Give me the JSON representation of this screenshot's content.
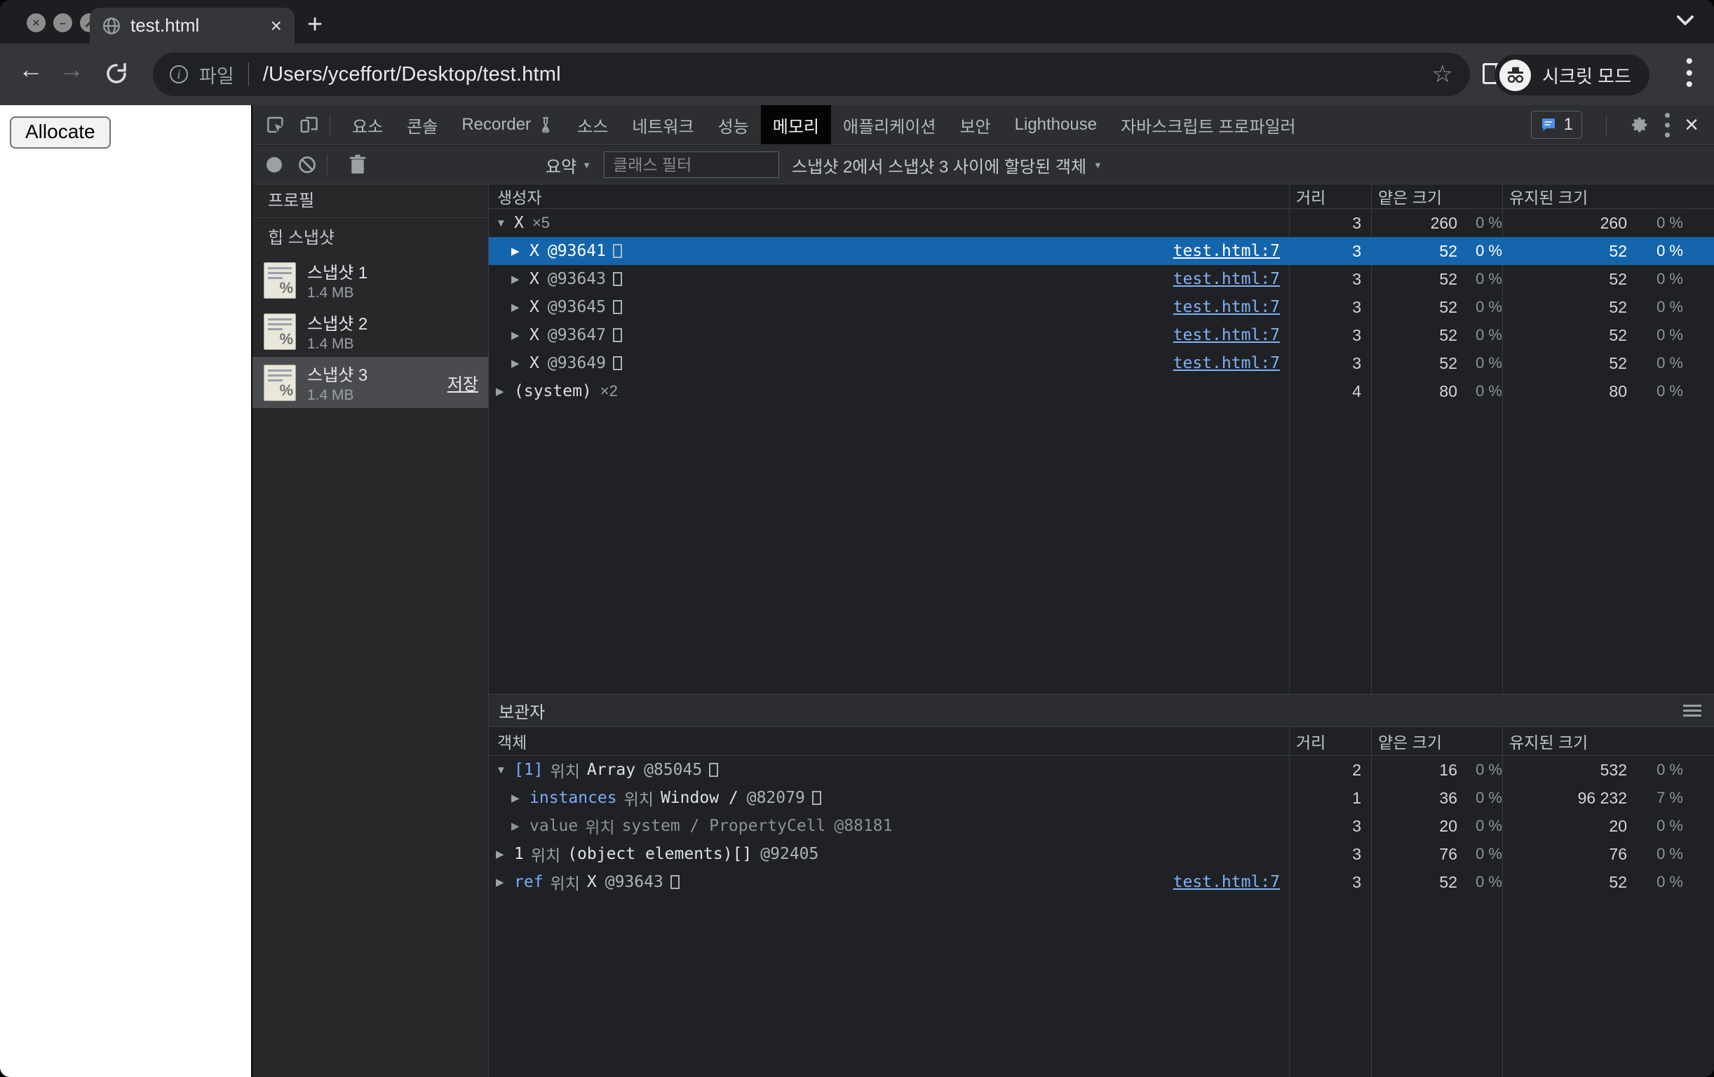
{
  "colors": {
    "selection_blue": "#1565ad",
    "link_blue": "#80b1f5",
    "property_blue": "#7cacf8",
    "selected_tab_bg": "#000000",
    "page_bg": "#ffffff"
  },
  "browser": {
    "window_controls": [
      "close",
      "minimize",
      "fullscreen"
    ],
    "tab_title": "test.html",
    "url_scheme": "파일",
    "url_path": "/Users/yceffort/Desktop/test.html",
    "incognito_label": "시크릿 모드"
  },
  "page": {
    "allocate_label": "Allocate"
  },
  "devtools": {
    "tabs": [
      {
        "label": "요소"
      },
      {
        "label": "콘솔"
      },
      {
        "label": "Recorder",
        "flask": true
      },
      {
        "label": "소스"
      },
      {
        "label": "네트워크"
      },
      {
        "label": "성능"
      },
      {
        "label": "메모리",
        "selected": true
      },
      {
        "label": "애플리케이션"
      },
      {
        "label": "보안"
      },
      {
        "label": "Lighthouse"
      },
      {
        "label": "자바스크립트 프로파일러"
      }
    ],
    "issues_count": "1",
    "toolbar": {
      "summary_label": "요약",
      "filter_placeholder": "클래스 필터",
      "allocation_filter": "스냅샷 2에서 스냅샷 3 사이에 할당된 객체"
    },
    "sidebar": {
      "profiles_label": "프로필",
      "section_label": "힙 스냅샷",
      "snapshots": [
        {
          "name": "스냅샷 1",
          "size": "1.4 MB"
        },
        {
          "name": "스냅샷 2",
          "size": "1.4 MB"
        },
        {
          "name": "스냅샷 3",
          "size": "1.4 MB",
          "selected": true,
          "save_label": "저장"
        }
      ]
    },
    "constructors": {
      "columns": {
        "constructor": "생성자",
        "distance": "거리",
        "shallow": "얕은 크기",
        "retained": "유지된 크기"
      },
      "rows": [
        {
          "indent": 0,
          "exp": "▼",
          "name": "X",
          "count": "×5",
          "dist": "3",
          "sh": "260",
          "shp": "0 %",
          "re": "260",
          "rep": "0 %"
        },
        {
          "indent": 1,
          "exp": "▶",
          "name": "X",
          "id": "@93641",
          "box": true,
          "link": "test.html:7",
          "dist": "3",
          "sh": "52",
          "shp": "0 %",
          "re": "52",
          "rep": "0 %",
          "selected": true
        },
        {
          "indent": 1,
          "exp": "▶",
          "name": "X",
          "id": "@93643",
          "box": true,
          "link": "test.html:7",
          "dist": "3",
          "sh": "52",
          "shp": "0 %",
          "re": "52",
          "rep": "0 %"
        },
        {
          "indent": 1,
          "exp": "▶",
          "name": "X",
          "id": "@93645",
          "box": true,
          "link": "test.html:7",
          "dist": "3",
          "sh": "52",
          "shp": "0 %",
          "re": "52",
          "rep": "0 %"
        },
        {
          "indent": 1,
          "exp": "▶",
          "name": "X",
          "id": "@93647",
          "box": true,
          "link": "test.html:7",
          "dist": "3",
          "sh": "52",
          "shp": "0 %",
          "re": "52",
          "rep": "0 %"
        },
        {
          "indent": 1,
          "exp": "▶",
          "name": "X",
          "id": "@93649",
          "box": true,
          "link": "test.html:7",
          "dist": "3",
          "sh": "52",
          "shp": "0 %",
          "re": "52",
          "rep": "0 %"
        },
        {
          "indent": 0,
          "exp": "▶",
          "name": "(system)",
          "count": "×2",
          "dist": "4",
          "sh": "80",
          "shp": "0 %",
          "re": "80",
          "rep": "0 %"
        }
      ]
    },
    "retainers": {
      "title": "보관자",
      "columns": {
        "object": "객체",
        "distance": "거리",
        "shallow": "얕은 크기",
        "retained": "유지된 크기"
      },
      "rows": [
        {
          "indent": 0,
          "exp": "▼",
          "prop": "[1]",
          "prop_style": "blue",
          "in": "위치",
          "obj": "Array",
          "id": "@85045",
          "box": true,
          "dist": "2",
          "sh": "16",
          "shp": "0 %",
          "re": "532",
          "rep": "0 %"
        },
        {
          "indent": 1,
          "exp": "▶",
          "prop": "instances",
          "prop_style": "blue",
          "in": "위치",
          "obj": "Window /",
          "id": "@82079",
          "box": true,
          "dist": "1",
          "sh": "36",
          "shp": "0 %",
          "re": "96 232",
          "rep": "7 %"
        },
        {
          "indent": 1,
          "exp": "▶",
          "prop": "value",
          "prop_style": "dim",
          "in": "위치",
          "obj": "system / PropertyCell",
          "id": "@88181",
          "dim": true,
          "dist": "3",
          "sh": "20",
          "shp": "0 %",
          "re": "20",
          "rep": "0 %"
        },
        {
          "indent": 0,
          "exp": "▶",
          "prop": "1",
          "prop_style": "light",
          "in": "위치",
          "obj": "(object elements)[]",
          "id": "@92405",
          "dist": "3",
          "sh": "76",
          "shp": "0 %",
          "re": "76",
          "rep": "0 %"
        },
        {
          "indent": 0,
          "exp": "▶",
          "prop": "ref",
          "prop_style": "blue",
          "in": "위치",
          "obj": "X",
          "id": "@93643",
          "box": true,
          "link": "test.html:7",
          "dist": "3",
          "sh": "52",
          "shp": "0 %",
          "re": "52",
          "rep": "0 %"
        }
      ]
    }
  }
}
